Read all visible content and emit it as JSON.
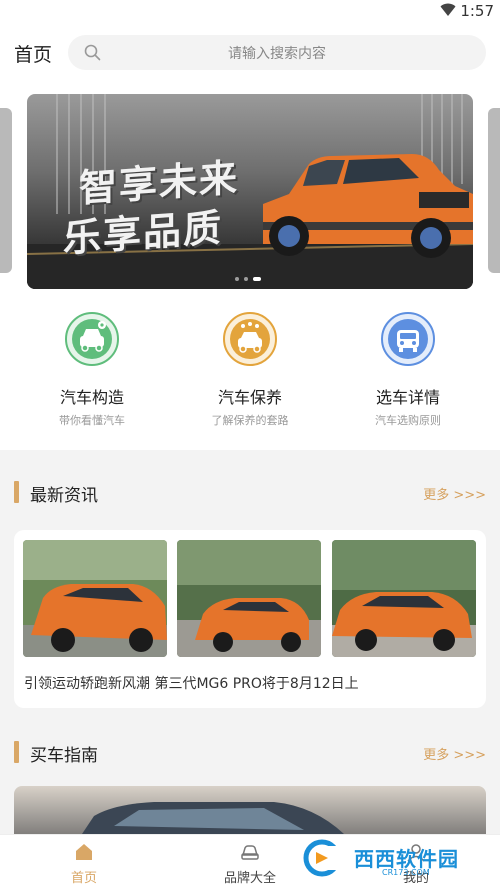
{
  "status_bar": {
    "time": "1:57"
  },
  "header": {
    "title": "首页",
    "search_placeholder": "请输入搜索内容"
  },
  "banner": {
    "slogan_line1": "智享未来",
    "slogan_line2": "乐享品质",
    "dot_count": 3,
    "active_dot": 2
  },
  "categories": [
    {
      "title": "汽车构造",
      "subtitle": "带你看懂汽车",
      "icon": "car-gear-icon",
      "color": "#5fbd7c"
    },
    {
      "title": "汽车保养",
      "subtitle": "了解保养的套路",
      "icon": "car-wash-icon",
      "color": "#e3a43c"
    },
    {
      "title": "选车详情",
      "subtitle": "汽车选购原则",
      "icon": "car-select-icon",
      "color": "#5d8fe0"
    }
  ],
  "news_section": {
    "title": "最新资讯",
    "more": "更多 >>>",
    "article_title": "引领运动轿跑新风潮 第三代MG6 PRO将于8月12日上"
  },
  "guide_section": {
    "title": "买车指南",
    "more": "更多 >>>"
  },
  "tabbar": [
    {
      "label": "首页",
      "icon": "home-icon",
      "active": true
    },
    {
      "label": "品牌大全",
      "icon": "car-icon",
      "active": false
    },
    {
      "label": "我的",
      "icon": "user-icon",
      "active": false
    }
  ],
  "watermark": {
    "text": "西西软件园",
    "sub": "CR173.COM"
  },
  "colors": {
    "accent": "#d9a766",
    "car_orange": "#e5742b"
  }
}
